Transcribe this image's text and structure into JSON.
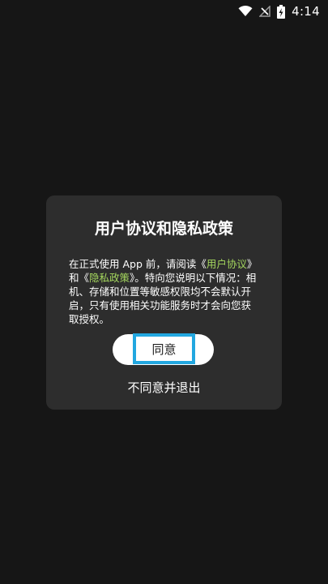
{
  "status_bar": {
    "time": "4:14",
    "icons": [
      "wifi-icon",
      "no-signal-icon",
      "battery-charging-icon"
    ]
  },
  "dialog": {
    "title": "用户协议和隐私政策",
    "body": {
      "part1": "在正式使用 App 前，请阅读《",
      "link1": "用户协议",
      "part2": "》和《",
      "link2": "隐私政策",
      "part3": "》。特向您说明以下情况：相机、存储和位置等敏感权限均不会默认开启，只有使用相关功能服务时才会向您获取授权。"
    },
    "agree_label": "同意",
    "disagree_label": "不同意并退出"
  },
  "colors": {
    "background": "#161616",
    "dialog": "#2d2d2d",
    "link": "#a4d65e",
    "focus": "#22a7e0"
  }
}
